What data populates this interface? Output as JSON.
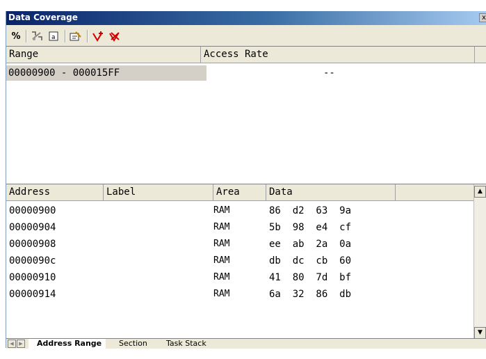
{
  "window": {
    "title": "Data Coverage",
    "close_label": "x"
  },
  "toolbar": {
    "icons": [
      "percent-icon",
      "range-icon",
      "label-icon",
      "edit-icon",
      "add-icon",
      "delete-icon"
    ],
    "percent_label": "%"
  },
  "range_panel": {
    "headers": [
      "Range",
      "Access Rate"
    ],
    "rows": [
      {
        "range": "00000900 - 000015FF",
        "rate": "--"
      }
    ]
  },
  "data_panel": {
    "headers": [
      "Address",
      "Label",
      "Area",
      "Data"
    ],
    "rows": [
      {
        "address": "00000900",
        "label": "",
        "area": "RAM",
        "data": "86  d2  63  9a"
      },
      {
        "address": "00000904",
        "label": "",
        "area": "RAM",
        "data": "5b  98  e4  cf"
      },
      {
        "address": "00000908",
        "label": "",
        "area": "RAM",
        "data": "ee  ab  2a  0a"
      },
      {
        "address": "0000090c",
        "label": "",
        "area": "RAM",
        "data": "db  dc  cb  60"
      },
      {
        "address": "00000910",
        "label": "",
        "area": "RAM",
        "data": "41  80  7d  bf"
      },
      {
        "address": "00000914",
        "label": "",
        "area": "RAM",
        "data": "6a  32  86  db"
      }
    ]
  },
  "tabs": [
    {
      "label": "Address Range",
      "active": true
    },
    {
      "label": "Section",
      "active": false
    },
    {
      "label": "Task Stack",
      "active": false
    }
  ],
  "colors": {
    "title_start": "#0a246a",
    "title_end": "#a6caf0",
    "selection": "#d4d0c8",
    "chrome": "#ece9d8"
  }
}
